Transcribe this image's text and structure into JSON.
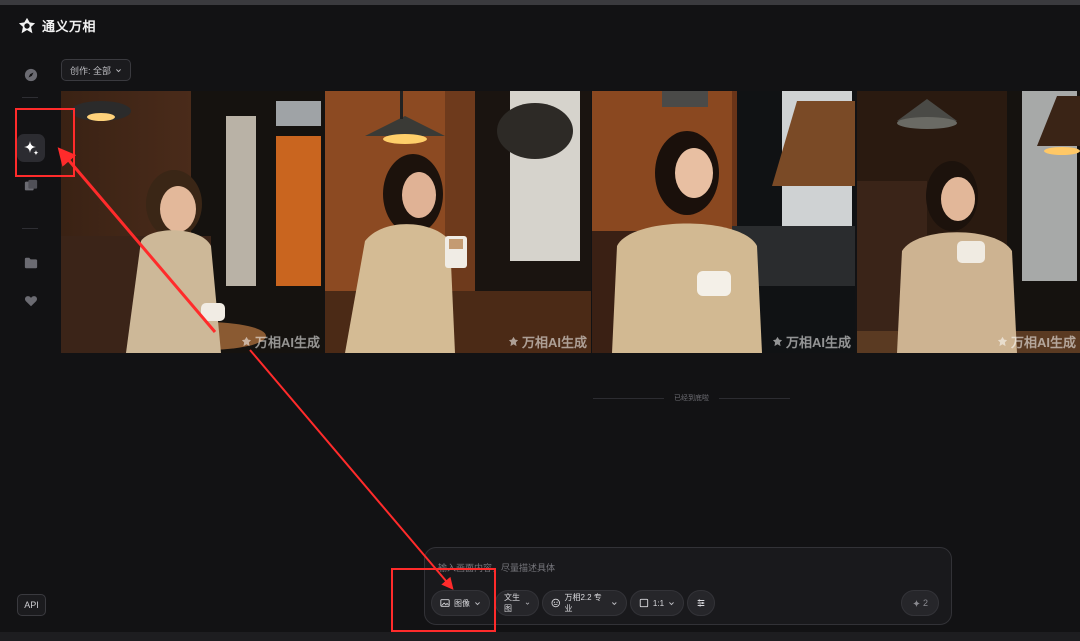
{
  "app": {
    "title": "通义万相"
  },
  "sidebar": {
    "items": [
      {
        "name": "explore-icon"
      },
      {
        "name": "sparkle-icon",
        "active": true
      },
      {
        "name": "gallery-icon"
      },
      {
        "name": "folder-icon"
      },
      {
        "name": "heart-icon"
      }
    ]
  },
  "filter": {
    "label": "创作: 全部"
  },
  "gallery": {
    "watermark": "万相AI生成",
    "images": [
      {
        "name": "generated-image-1"
      },
      {
        "name": "generated-image-2"
      },
      {
        "name": "generated-image-3"
      },
      {
        "name": "generated-image-4"
      }
    ]
  },
  "end_note": "已经到底啦",
  "api_button": "API",
  "composer": {
    "placeholder": "输入画面内容，尽量描述具体",
    "mode_label": "图像",
    "type_label": "文生图",
    "model_label": "万相2.2 专业",
    "ratio_label": "1:1",
    "credits": "2"
  },
  "colors": {
    "highlight": "#ff2b2b",
    "background": "#121214"
  }
}
